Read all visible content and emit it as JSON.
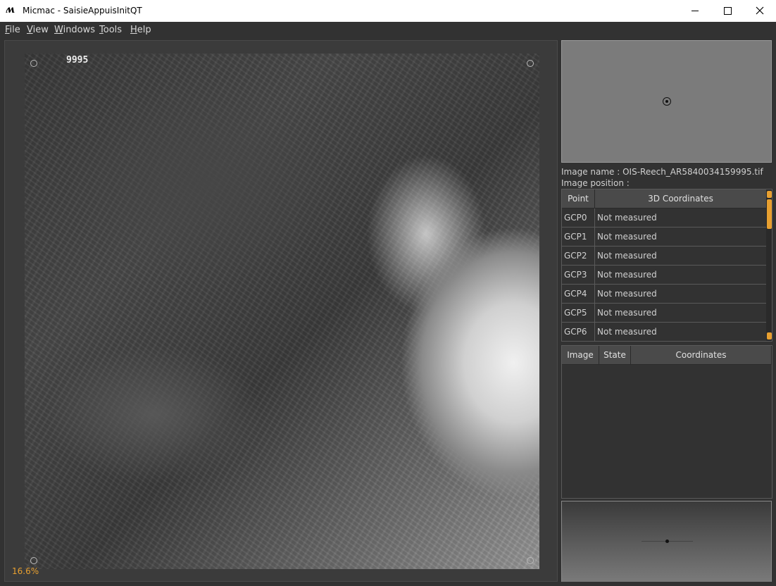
{
  "window": {
    "icon": "ʍ",
    "title": "Micmac - SaisieAppuisInitQT",
    "minimize_icon": "minimize-icon",
    "maximize_icon": "maximize-icon",
    "close_icon": "close-icon"
  },
  "menu": {
    "items": [
      {
        "label": "File"
      },
      {
        "label": "View"
      },
      {
        "label": "Windows"
      },
      {
        "label": "Tools"
      },
      {
        "label": "Help"
      }
    ]
  },
  "viewer": {
    "photo_label": "9995",
    "zoom_level": "16.6%"
  },
  "info": {
    "image_name": "Image name : OIS-Reech_AR5840034159995.tif",
    "image_position": "Image position :"
  },
  "points_table": {
    "headers": [
      "Point",
      "3D Coordinates"
    ],
    "rows": [
      {
        "point": "GCP0",
        "coords": "Not measured"
      },
      {
        "point": "GCP1",
        "coords": "Not measured"
      },
      {
        "point": "GCP2",
        "coords": "Not measured"
      },
      {
        "point": "GCP3",
        "coords": "Not measured"
      },
      {
        "point": "GCP4",
        "coords": "Not measured"
      },
      {
        "point": "GCP5",
        "coords": "Not measured"
      },
      {
        "point": "GCP6",
        "coords": "Not measured"
      }
    ]
  },
  "measures_table": {
    "headers": [
      "Image",
      "State",
      "Coordinates"
    ]
  },
  "colors": {
    "accent": "#e8a030",
    "background": "#323232"
  }
}
